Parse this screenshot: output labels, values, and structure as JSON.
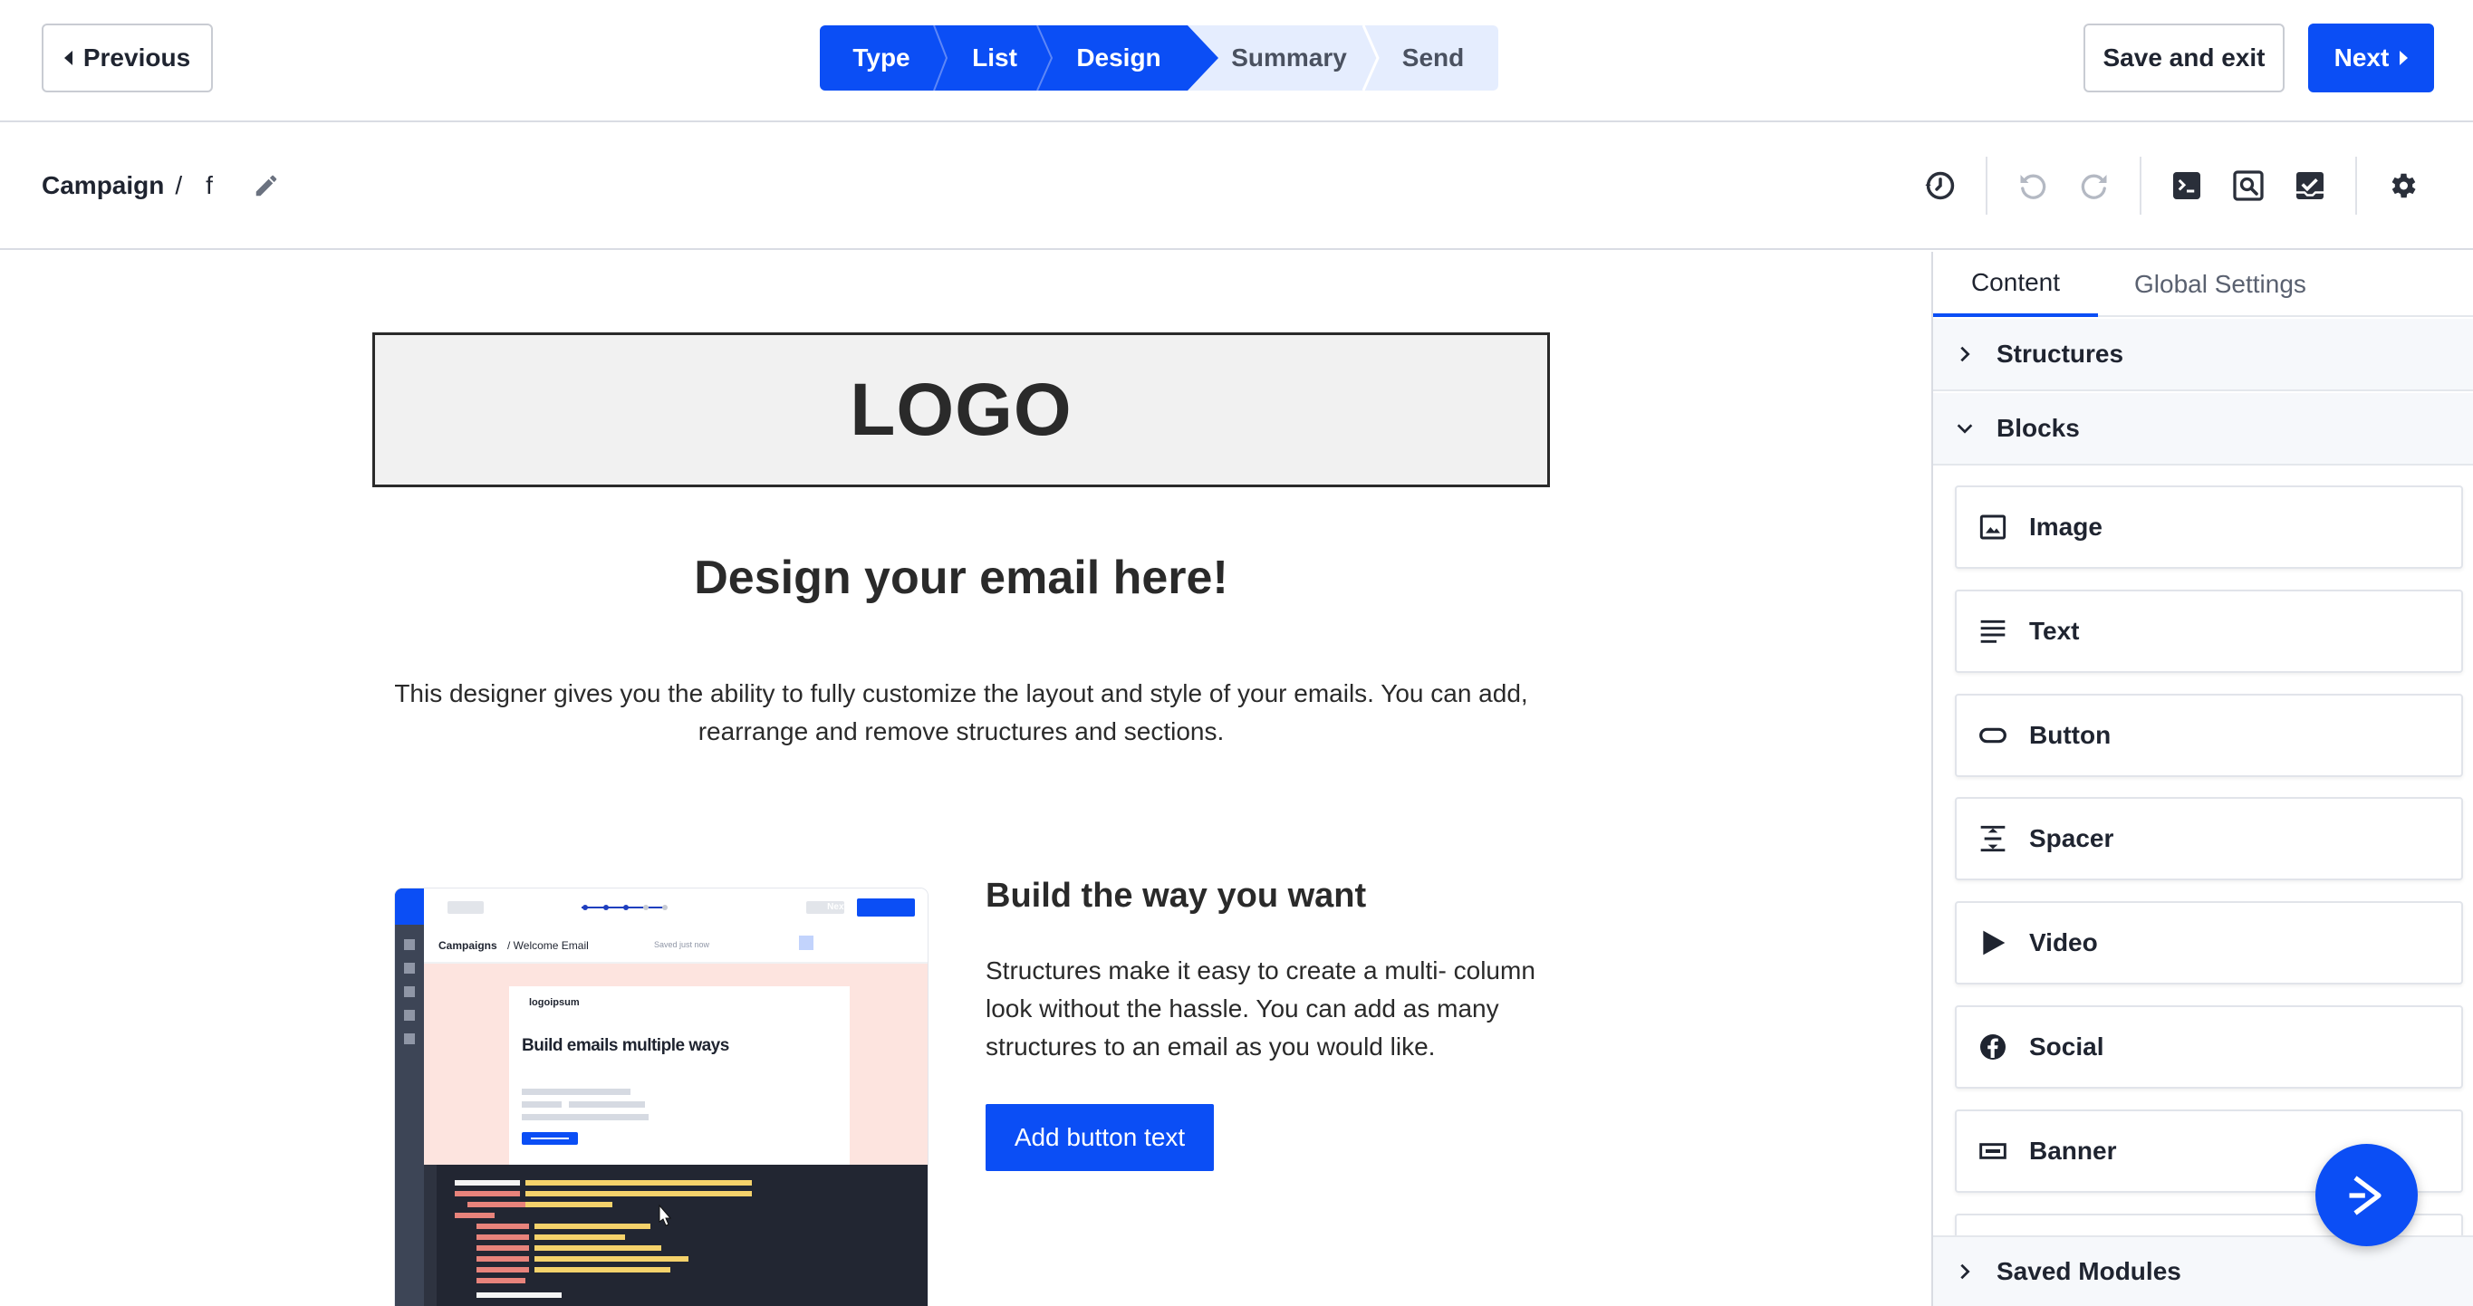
{
  "topbar": {
    "previous_label": "Previous",
    "save_exit_label": "Save and exit",
    "next_label": "Next",
    "steps": [
      {
        "label": "Type",
        "state": "done"
      },
      {
        "label": "List",
        "state": "done"
      },
      {
        "label": "Design",
        "state": "current"
      },
      {
        "label": "Summary",
        "state": "todo"
      },
      {
        "label": "Send",
        "state": "todo"
      }
    ],
    "accent_color": "#0b4ef5"
  },
  "subbar": {
    "breadcrumb_root": "Campaign",
    "breadcrumb_sep": "/",
    "campaign_name": "f",
    "tools": [
      "history-icon",
      "undo-icon",
      "redo-icon",
      "code-icon",
      "preview-icon",
      "test-check-icon",
      "gear-icon"
    ]
  },
  "canvas": {
    "logo_text": "LOGO",
    "headline": "Design your email here!",
    "intro": "This designer gives you the ability to fully customize the layout and style of your emails. You can add, rearrange and remove structures and sections.",
    "column_title": "Build the way you want",
    "column_text": "Structures make it easy to create a multi- column look without the hassle. You can add as many structures to an email as you would like.",
    "column_button": "Add button text",
    "screenshot": {
      "next_label": "Next",
      "crumb_root": "Campaigns",
      "crumb_name": "/ Welcome Email",
      "saved_text": "Saved just now",
      "brand": "logoipsum",
      "card_title": "Build emails multiple ways"
    }
  },
  "panel": {
    "tab_content": "Content",
    "tab_global": "Global Settings",
    "structures_label": "Structures",
    "blocks_label": "Blocks",
    "saved_modules_label": "Saved Modules",
    "blocks": [
      {
        "label": "Image",
        "icon": "image-icon"
      },
      {
        "label": "Text",
        "icon": "text-icon"
      },
      {
        "label": "Button",
        "icon": "button-icon"
      },
      {
        "label": "Spacer",
        "icon": "spacer-icon"
      },
      {
        "label": "Video",
        "icon": "video-icon"
      },
      {
        "label": "Social",
        "icon": "facebook-icon"
      },
      {
        "label": "Banner",
        "icon": "banner-icon"
      }
    ]
  }
}
